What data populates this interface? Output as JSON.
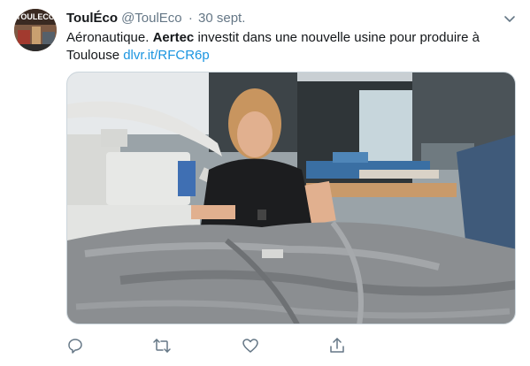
{
  "tweet": {
    "author_name": "ToulÉco",
    "handle": "@ToulEco",
    "separator": "·",
    "date": "30 sept.",
    "text_part1": "Aéronautique. ",
    "text_bold": "Aertec",
    "text_part2": " investit dans une nouvelle usine pour produire à Toulouse ",
    "link": "dlvr.it/RFCR6p",
    "avatar_text": "TOULECO"
  },
  "icons": {
    "menu": "chevron-down-icon",
    "reply": "reply-icon",
    "retweet": "retweet-icon",
    "like": "heart-icon",
    "share": "share-icon"
  },
  "colors": {
    "name": "#14171a",
    "meta": "#657786",
    "link": "#1b95e0",
    "icon": "#657786"
  }
}
